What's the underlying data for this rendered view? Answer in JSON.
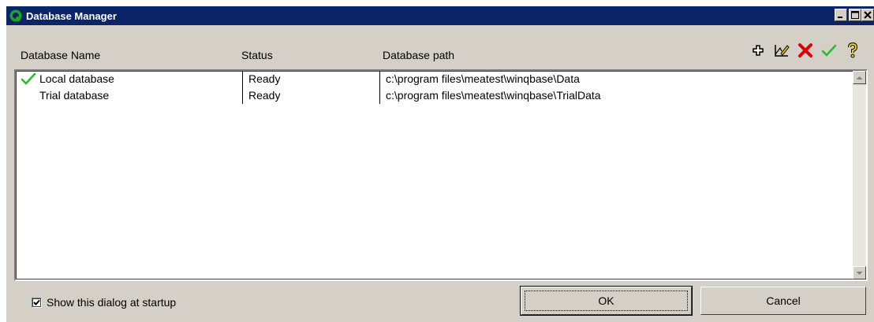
{
  "window": {
    "title": "Database Manager",
    "icons": {
      "app": "app-q-icon",
      "minimize": "minimize-icon",
      "maximize": "maximize-icon",
      "close": "close-icon"
    }
  },
  "columns": {
    "name": "Database Name",
    "status": "Status",
    "path": "Database path"
  },
  "toolbar": {
    "icons": [
      "add-icon",
      "edit-icon",
      "delete-icon",
      "set-active-icon",
      "help-icon"
    ]
  },
  "databases": [
    {
      "name": "Local database",
      "status": "Ready",
      "path": "c:\\program files\\meatest\\winqbase\\Data",
      "active": true
    },
    {
      "name": "Trial database",
      "status": "Ready",
      "path": "c:\\program files\\meatest\\winqbase\\TrialData",
      "active": false
    }
  ],
  "footer": {
    "show_at_startup_label": "Show this dialog at startup",
    "show_at_startup_checked": true,
    "ok_label": "OK",
    "cancel_label": "Cancel"
  },
  "colors": {
    "titlebar": "#0a246a",
    "dialog_bg": "#d4d0c8",
    "check_green": "#22c022",
    "delete_red": "#e00000"
  }
}
